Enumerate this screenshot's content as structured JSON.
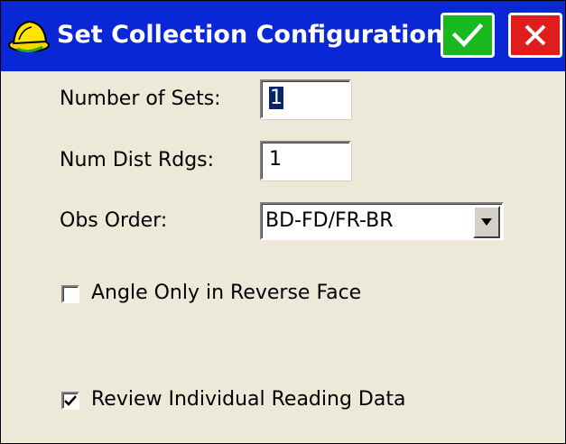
{
  "title": "Set Collection Configuration",
  "colors": {
    "titlebar": "#0a27d6",
    "ok": "#19b820",
    "close": "#e01c1c",
    "background": "#ece9d8"
  },
  "icons": {
    "app": "hardhat-icon",
    "ok": "checkmark-icon",
    "close": "x-icon",
    "dropdown": "triangle-down-icon"
  },
  "fields": {
    "num_sets": {
      "label": "Number of Sets:",
      "value": "1"
    },
    "num_dist_rdgs": {
      "label": "Num Dist Rdgs:",
      "value": "1"
    },
    "obs_order": {
      "label": "Obs Order:",
      "value": "BD-FD/FR-BR"
    }
  },
  "options": {
    "angle_only_reverse": {
      "label": "Angle Only in Reverse Face",
      "checked": false
    },
    "review_individual": {
      "label": "Review Individual Reading Data",
      "checked": true
    }
  }
}
